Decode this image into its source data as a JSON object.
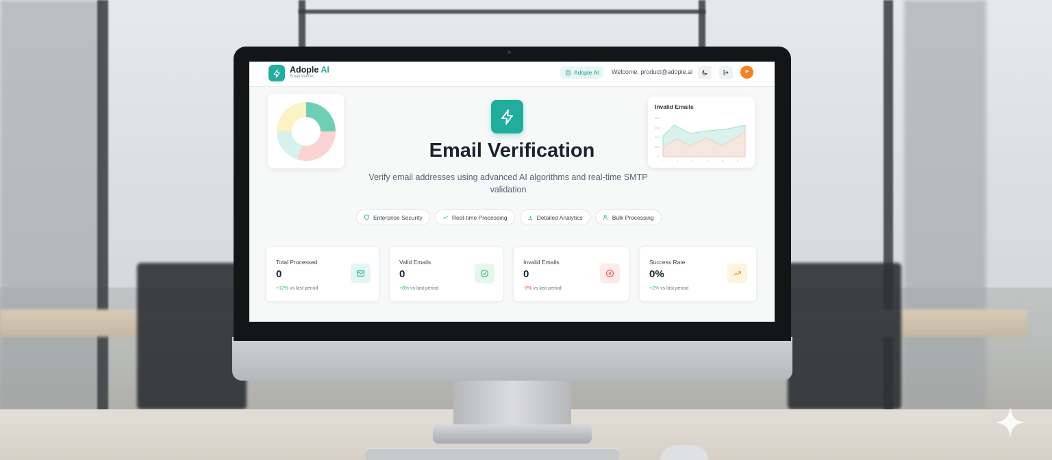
{
  "header": {
    "brand_name": "Adople",
    "brand_accent": "AI",
    "brand_subtitle": "Email Verifier",
    "org_badge": "Adople AI",
    "welcome_text": "Welcome, product@adople.ai",
    "avatar_initial": "P"
  },
  "decor": {
    "mini_chart_title": "Invalid Emails",
    "donut_colors": [
      "#6fcfb4",
      "#fbd4d2",
      "#d7f1ec",
      "#fbf3c4"
    ]
  },
  "hero": {
    "title": "Email Verification",
    "description": "Verify email addresses using advanced AI algorithms and real-time SMTP validation"
  },
  "features": [
    {
      "label": "Enterprise Security",
      "icon": "shield-icon"
    },
    {
      "label": "Real-time Processing",
      "icon": "trend-icon"
    },
    {
      "label": "Detailed Analytics",
      "icon": "bar-chart-icon"
    },
    {
      "label": "Bulk Processing",
      "icon": "users-icon"
    }
  ],
  "stats": [
    {
      "label": "Total Processed",
      "value": "0",
      "change": "+12%",
      "change_suffix": "vs last period",
      "icon": "mail-icon",
      "color": "#20b0a0"
    },
    {
      "label": "Valid Emails",
      "value": "0",
      "change": "+8%",
      "change_suffix": "vs last period",
      "icon": "check-circle-icon",
      "color": "#2bb673"
    },
    {
      "label": "Invalid Emails",
      "value": "0",
      "change": "-3%",
      "change_suffix": "vs last period",
      "icon": "x-circle-icon",
      "color": "#e5484d"
    },
    {
      "label": "Success Rate",
      "value": "0%",
      "change": "+2%",
      "change_suffix": "vs last period",
      "icon": "trending-up-icon",
      "color": "#f0a020"
    }
  ],
  "colors": {
    "accent": "#20b0a0",
    "avatar": "#f58220"
  }
}
